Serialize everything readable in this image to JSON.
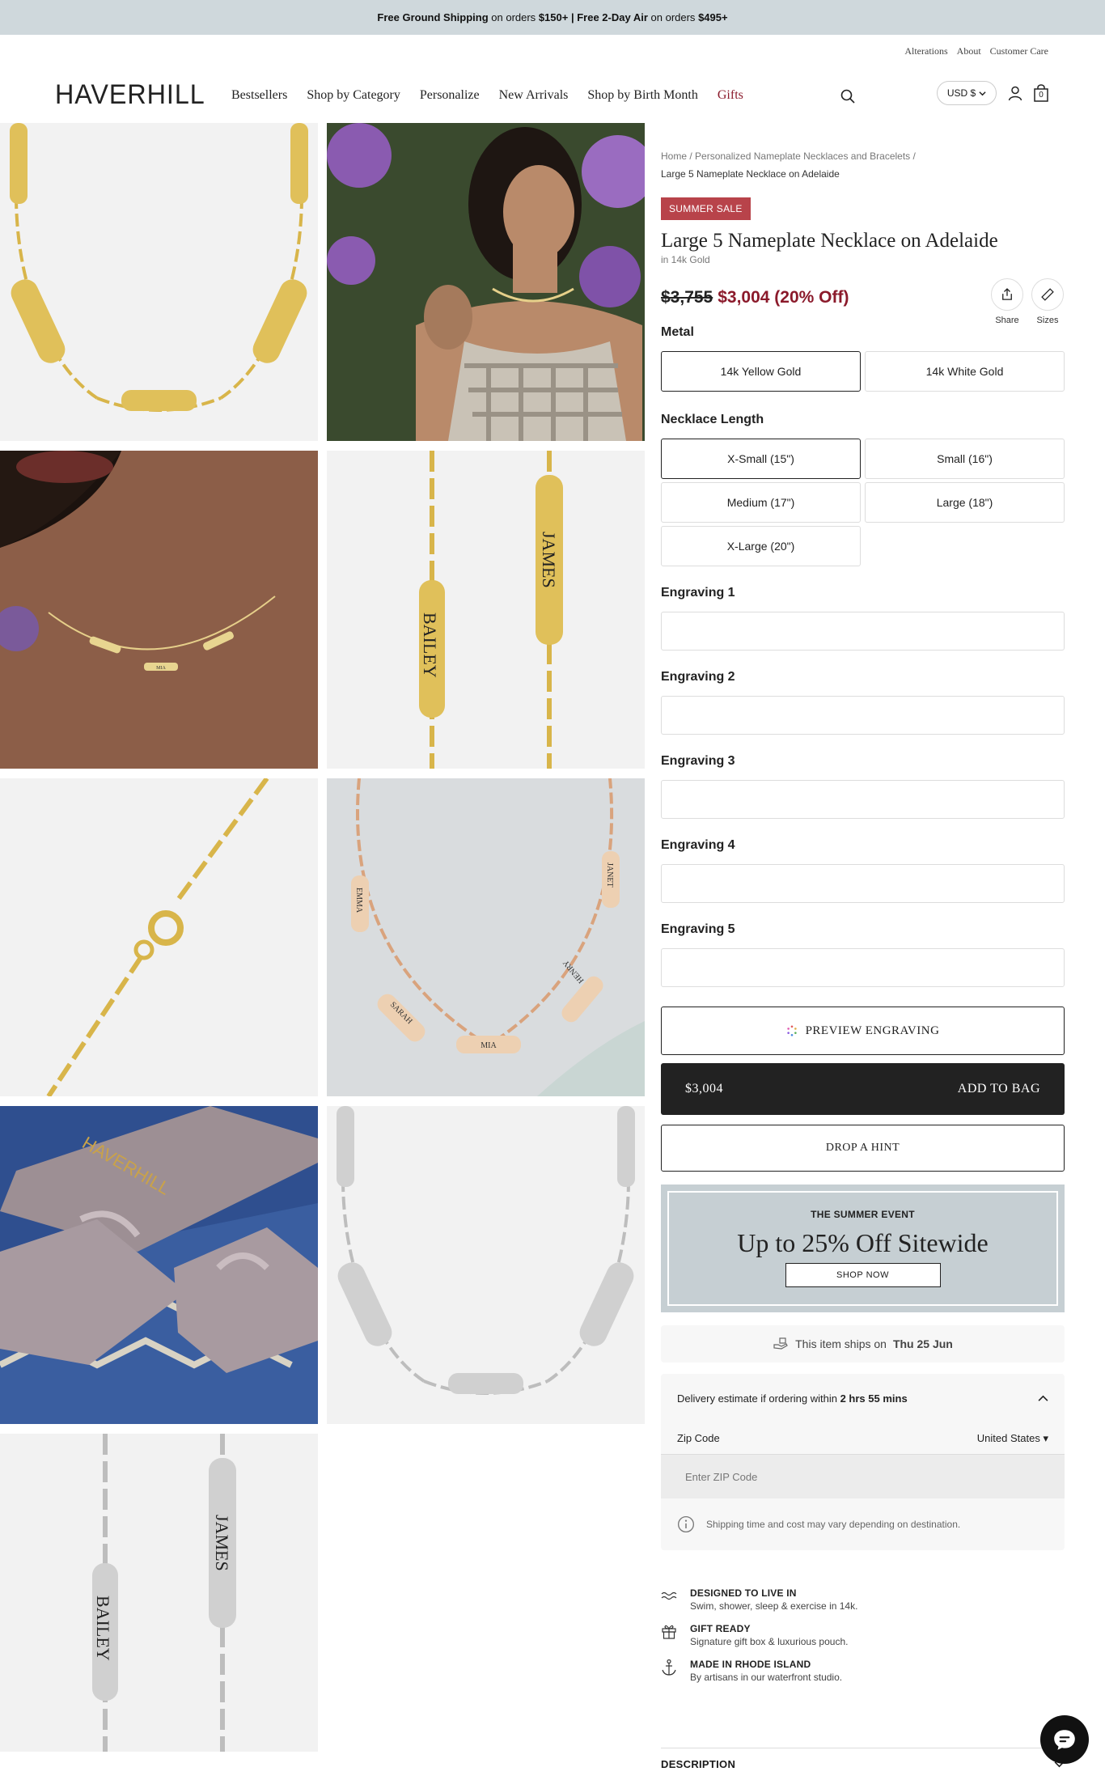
{
  "announcement": {
    "part1_bold": "Free Ground Shipping",
    "part1_rest": "on orders",
    "part1_amount": "$150+",
    "sep": "|",
    "part2_bold": "Free 2-Day Air",
    "part2_rest": "on orders",
    "part2_amount": "$495+"
  },
  "utility_links": [
    "Alterations",
    "About",
    "Customer Care"
  ],
  "header": {
    "logo": "HAVERHILL",
    "nav": [
      "Bestsellers",
      "Shop by Category",
      "Personalize",
      "New Arrivals",
      "Shop by Birth Month",
      "Gifts"
    ],
    "currency": "USD $",
    "icons": [
      "search-icon",
      "account-icon",
      "bag-icon"
    ],
    "bag_count": "0"
  },
  "gallery": {
    "engravings": {
      "pendant_a": "BAILEY",
      "pendant_b": "JAMES",
      "rose_top_left": "EMMA",
      "rose_top_right": "JANET",
      "rose_bottom_left": "SARAH",
      "rose_center": "MIA",
      "rose_bottom_right": "HENRY",
      "neck_center": "MIA",
      "box_logo": "HAVERHILL"
    }
  },
  "breadcrumb": {
    "home": "Home",
    "category": "Personalized Nameplate Necklaces and Bracelets",
    "current": "Large 5 Nameplate Necklace on Adelaide"
  },
  "product": {
    "badge": "SUMMER SALE",
    "title": "Large 5 Nameplate Necklace on Adelaide",
    "subtitle": "in 14k Gold",
    "price_old": "$3,755",
    "price_new": "$3,004 (20% Off)",
    "share_label": "Share",
    "sizes_label": "Sizes"
  },
  "metal": {
    "label": "Metal",
    "options": [
      "14k Yellow Gold",
      "14k White Gold"
    ],
    "selected": "14k Yellow Gold"
  },
  "length": {
    "label": "Necklace Length",
    "options": [
      "X-Small (15\")",
      "Small (16\")",
      "Medium (17\")",
      "Large (18\")",
      "X-Large (20\")"
    ],
    "selected": "X-Small (15\")"
  },
  "engravings": [
    "Engraving 1",
    "Engraving 2",
    "Engraving 3",
    "Engraving 4",
    "Engraving 5"
  ],
  "actions": {
    "preview": "PREVIEW ENGRAVING",
    "price": "$3,004",
    "add_to_bag": "ADD TO BAG",
    "hint": "DROP A HINT"
  },
  "promo": {
    "kicker": "THE SUMMER EVENT",
    "headline": "Up to 25% Off Sitewide",
    "cta": "SHOP NOW"
  },
  "shipping": {
    "ships_text": "This item ships on",
    "ships_date": "Thu 25 Jun"
  },
  "delivery": {
    "estimate_text": "Delivery estimate if ordering within",
    "estimate_time": "2 hrs 55 mins",
    "zip_label": "Zip Code",
    "country": "United States",
    "zip_placeholder": "Enter ZIP Code",
    "note": "Shipping time and cost may vary depending on destination."
  },
  "features": [
    {
      "title": "DESIGNED TO LIVE IN",
      "desc": "Swim, shower, sleep & exercise in 14k.",
      "icon": "waves-icon"
    },
    {
      "title": "GIFT READY",
      "desc": "Signature gift box & luxurious pouch.",
      "icon": "gift-icon"
    },
    {
      "title": "MADE IN RHODE ISLAND",
      "desc": "By artisans in our waterfront studio.",
      "icon": "anchor-icon"
    }
  ],
  "description_label": "DESCRIPTION",
  "colors": {
    "announcement_bg": "#cfd8dc",
    "accent_red": "#8b1a2b",
    "badge_red": "#b8434a",
    "promo_bg": "#c6cfd3",
    "gold": "#d8b54a",
    "silver": "#c8c8c8"
  }
}
